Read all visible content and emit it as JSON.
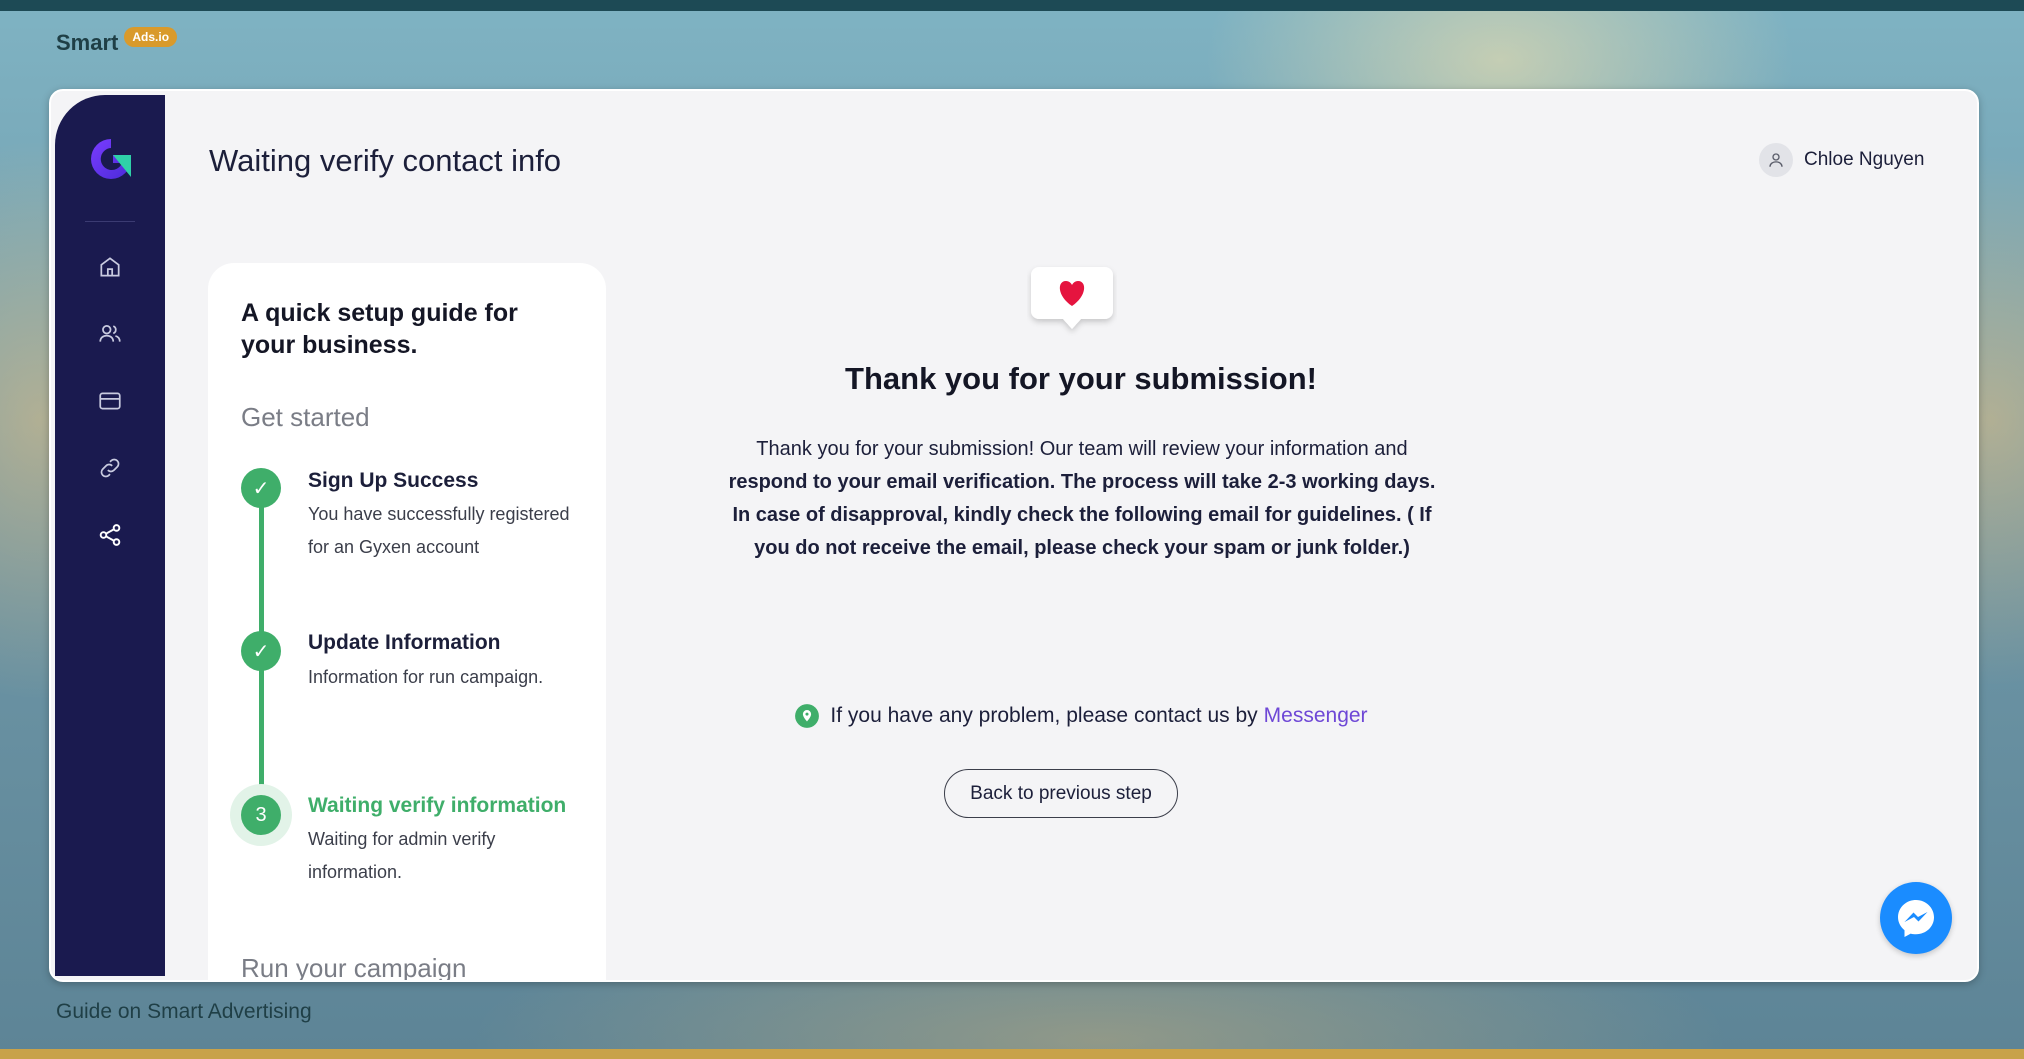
{
  "brand": {
    "name": "Smart",
    "badge": "Ads.io"
  },
  "footer": {
    "title": "Guide on Smart Advertising"
  },
  "header": {
    "title": "Waiting verify contact info",
    "user_name": "Chloe Nguyen"
  },
  "sidebar": {
    "icons": [
      "home-icon",
      "users-icon",
      "credit-card-icon",
      "link-icon",
      "share-icon"
    ]
  },
  "guide": {
    "title": "A quick setup guide for your business.",
    "section_get_started": "Get started",
    "section_run": "Run your campaign",
    "steps": [
      {
        "marker": "✓",
        "title": "Sign Up Success",
        "desc": "You have successfully registered for an Gyxen account"
      },
      {
        "marker": "✓",
        "title": "Update Information",
        "desc": "Information for run campaign."
      },
      {
        "marker": "3",
        "title": "Waiting verify information",
        "desc": "Waiting for admin verify information."
      }
    ]
  },
  "main": {
    "title": "Thank you for your submission!",
    "body_plain": "Thank you for your submission! Our team will review your information and ",
    "body_strong": "respond to your email verification. The process will take 2-3 working days. In case of disapproval, kindly check the following email for guidelines. ( If you do not receive the email, please check your spam or junk folder.)",
    "contact_text": "If you have any problem, please contact us by",
    "contact_link": "Messenger",
    "back_button": "Back to previous step"
  },
  "colors": {
    "accent_green": "#3fae6a",
    "sidebar": "#1a1a4f",
    "link": "#6e47d6",
    "messenger": "#1a8cff"
  }
}
